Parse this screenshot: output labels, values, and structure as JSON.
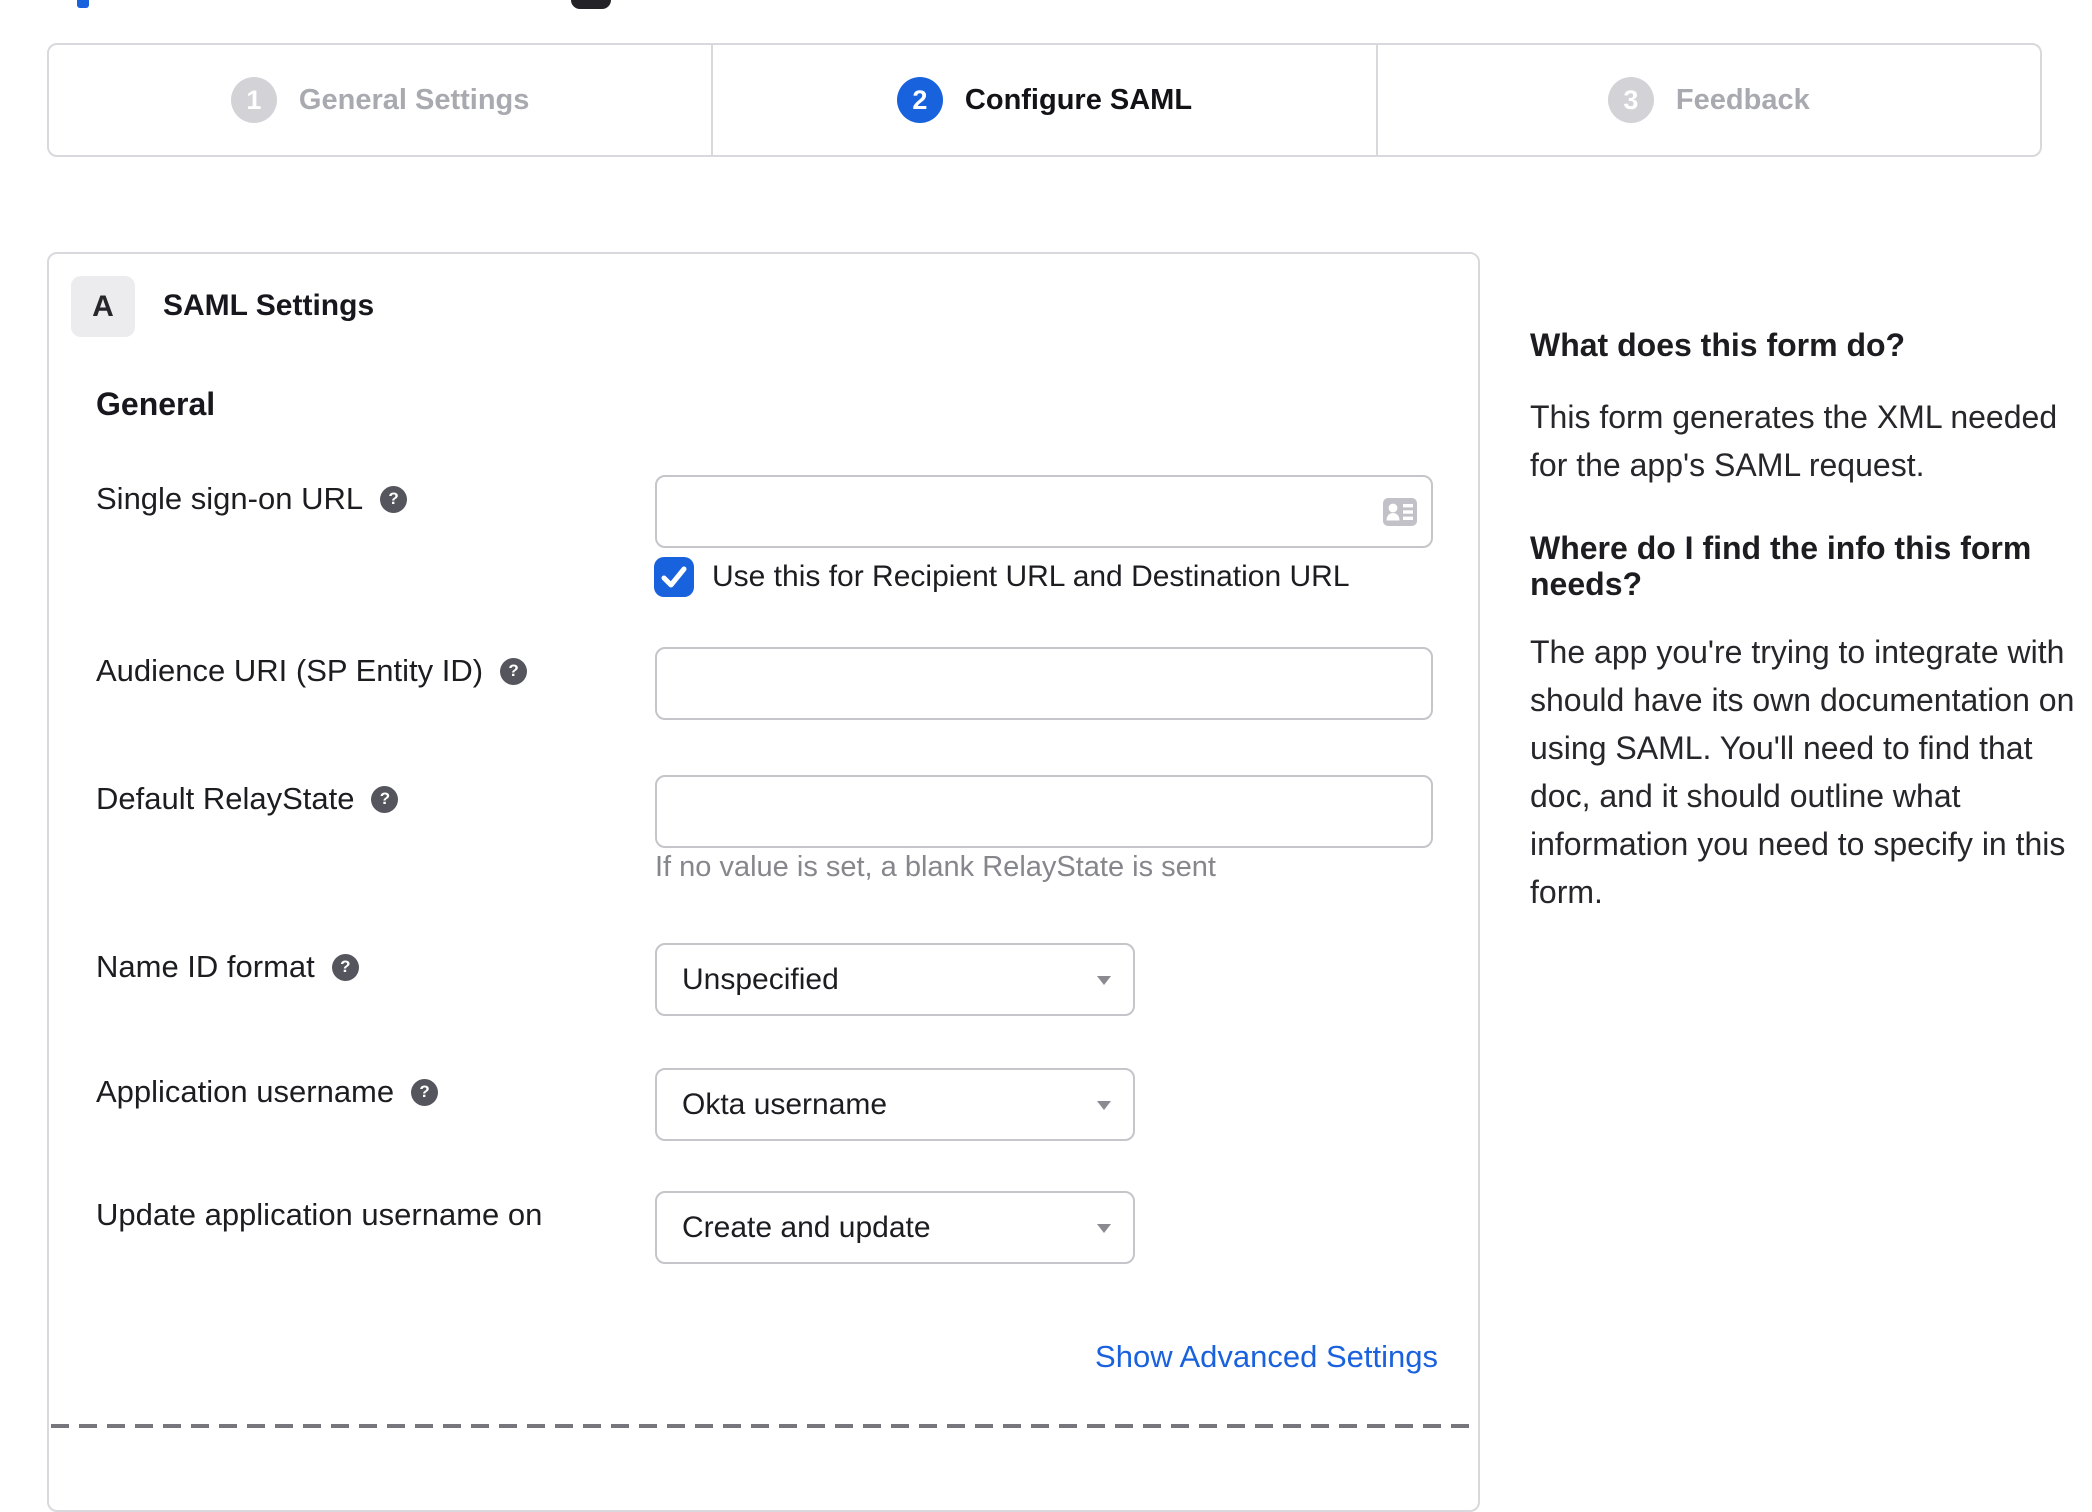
{
  "remnants": {
    "blue": "#1862dd",
    "dark": "#222227"
  },
  "stepper": {
    "steps": [
      {
        "number": "1",
        "label": "General Settings",
        "active": false
      },
      {
        "number": "2",
        "label": "Configure SAML",
        "active": true
      },
      {
        "number": "3",
        "label": "Feedback",
        "active": false
      }
    ]
  },
  "panel": {
    "section_badge": "A",
    "section_title": "SAML Settings",
    "group_heading": "General",
    "rows": [
      {
        "label": "Single sign-on URL",
        "type": "input",
        "value": ""
      },
      {
        "label": "Audience URI (SP Entity ID)",
        "type": "input",
        "value": ""
      },
      {
        "label": "Default RelayState",
        "type": "input",
        "value": "",
        "hint": "If no value is set, a blank RelayState is sent"
      },
      {
        "label": "Name ID format",
        "type": "select",
        "value": "Unspecified"
      },
      {
        "label": "Application username",
        "type": "select",
        "value": "Okta username"
      },
      {
        "label": "Update application username on",
        "type": "select",
        "value": "Create and update"
      }
    ],
    "checkbox": {
      "checked": true,
      "label": "Use this for Recipient URL and Destination URL"
    },
    "advanced_link": "Show Advanced Settings"
  },
  "icons": {
    "help": "?"
  },
  "sidebar": {
    "heading1": "What does this form do?",
    "para1": "This form generates the XML needed for the app's SAML request.",
    "heading2": "Where do I find the info this form needs?",
    "para2": "The app you're trying to integrate with should have its own documentation on using SAML. You'll need to find that doc, and it should outline what information you need to specify in this form."
  },
  "colors": {
    "accent_blue": "#1862dd",
    "border": "#d9d9dd",
    "input_border": "#c5c5ca",
    "muted_text": "#86868d"
  }
}
